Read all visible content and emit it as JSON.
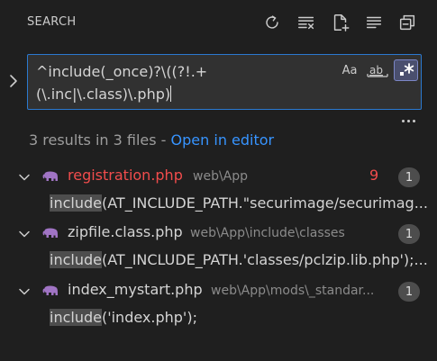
{
  "header": {
    "title": "SEARCH",
    "actions": [
      "refresh-icon",
      "clear-results-icon",
      "new-search-editor-icon",
      "view-as-tree-icon",
      "collapse-all-icon"
    ]
  },
  "search": {
    "query_line1": "^include(_once)?\\((?!.+",
    "query_line2": "(\\.inc|\\.class)\\.php)",
    "options": {
      "match_case": "Aa",
      "whole_word": "ab",
      "regex": ".*"
    },
    "regex_enabled": true
  },
  "summary": {
    "text": "3 results in 3 files - ",
    "link": "Open in editor"
  },
  "results": [
    {
      "file": "registration.php",
      "path": "web\\App",
      "problems": "9",
      "count": "1",
      "has_error": true,
      "match_hl": "include",
      "match_rest": "(AT_INCLUDE_PATH.\"securimage/securimag..."
    },
    {
      "file": "zipfile.class.php",
      "path": "web\\App\\include\\classes",
      "count": "1",
      "has_error": false,
      "match_hl": "include",
      "match_rest": "(AT_INCLUDE_PATH.'classes/pclzip.lib.php');..."
    },
    {
      "file": "index_mystart.php",
      "path": "web\\App\\mods\\_standar...",
      "count": "1",
      "has_error": false,
      "match_hl": "include",
      "match_rest": "('index.php');"
    }
  ],
  "colors": {
    "background": "#1f1f1f",
    "accent": "#3794ff",
    "error": "#f14c4c",
    "php_icon": "#a074c4"
  }
}
